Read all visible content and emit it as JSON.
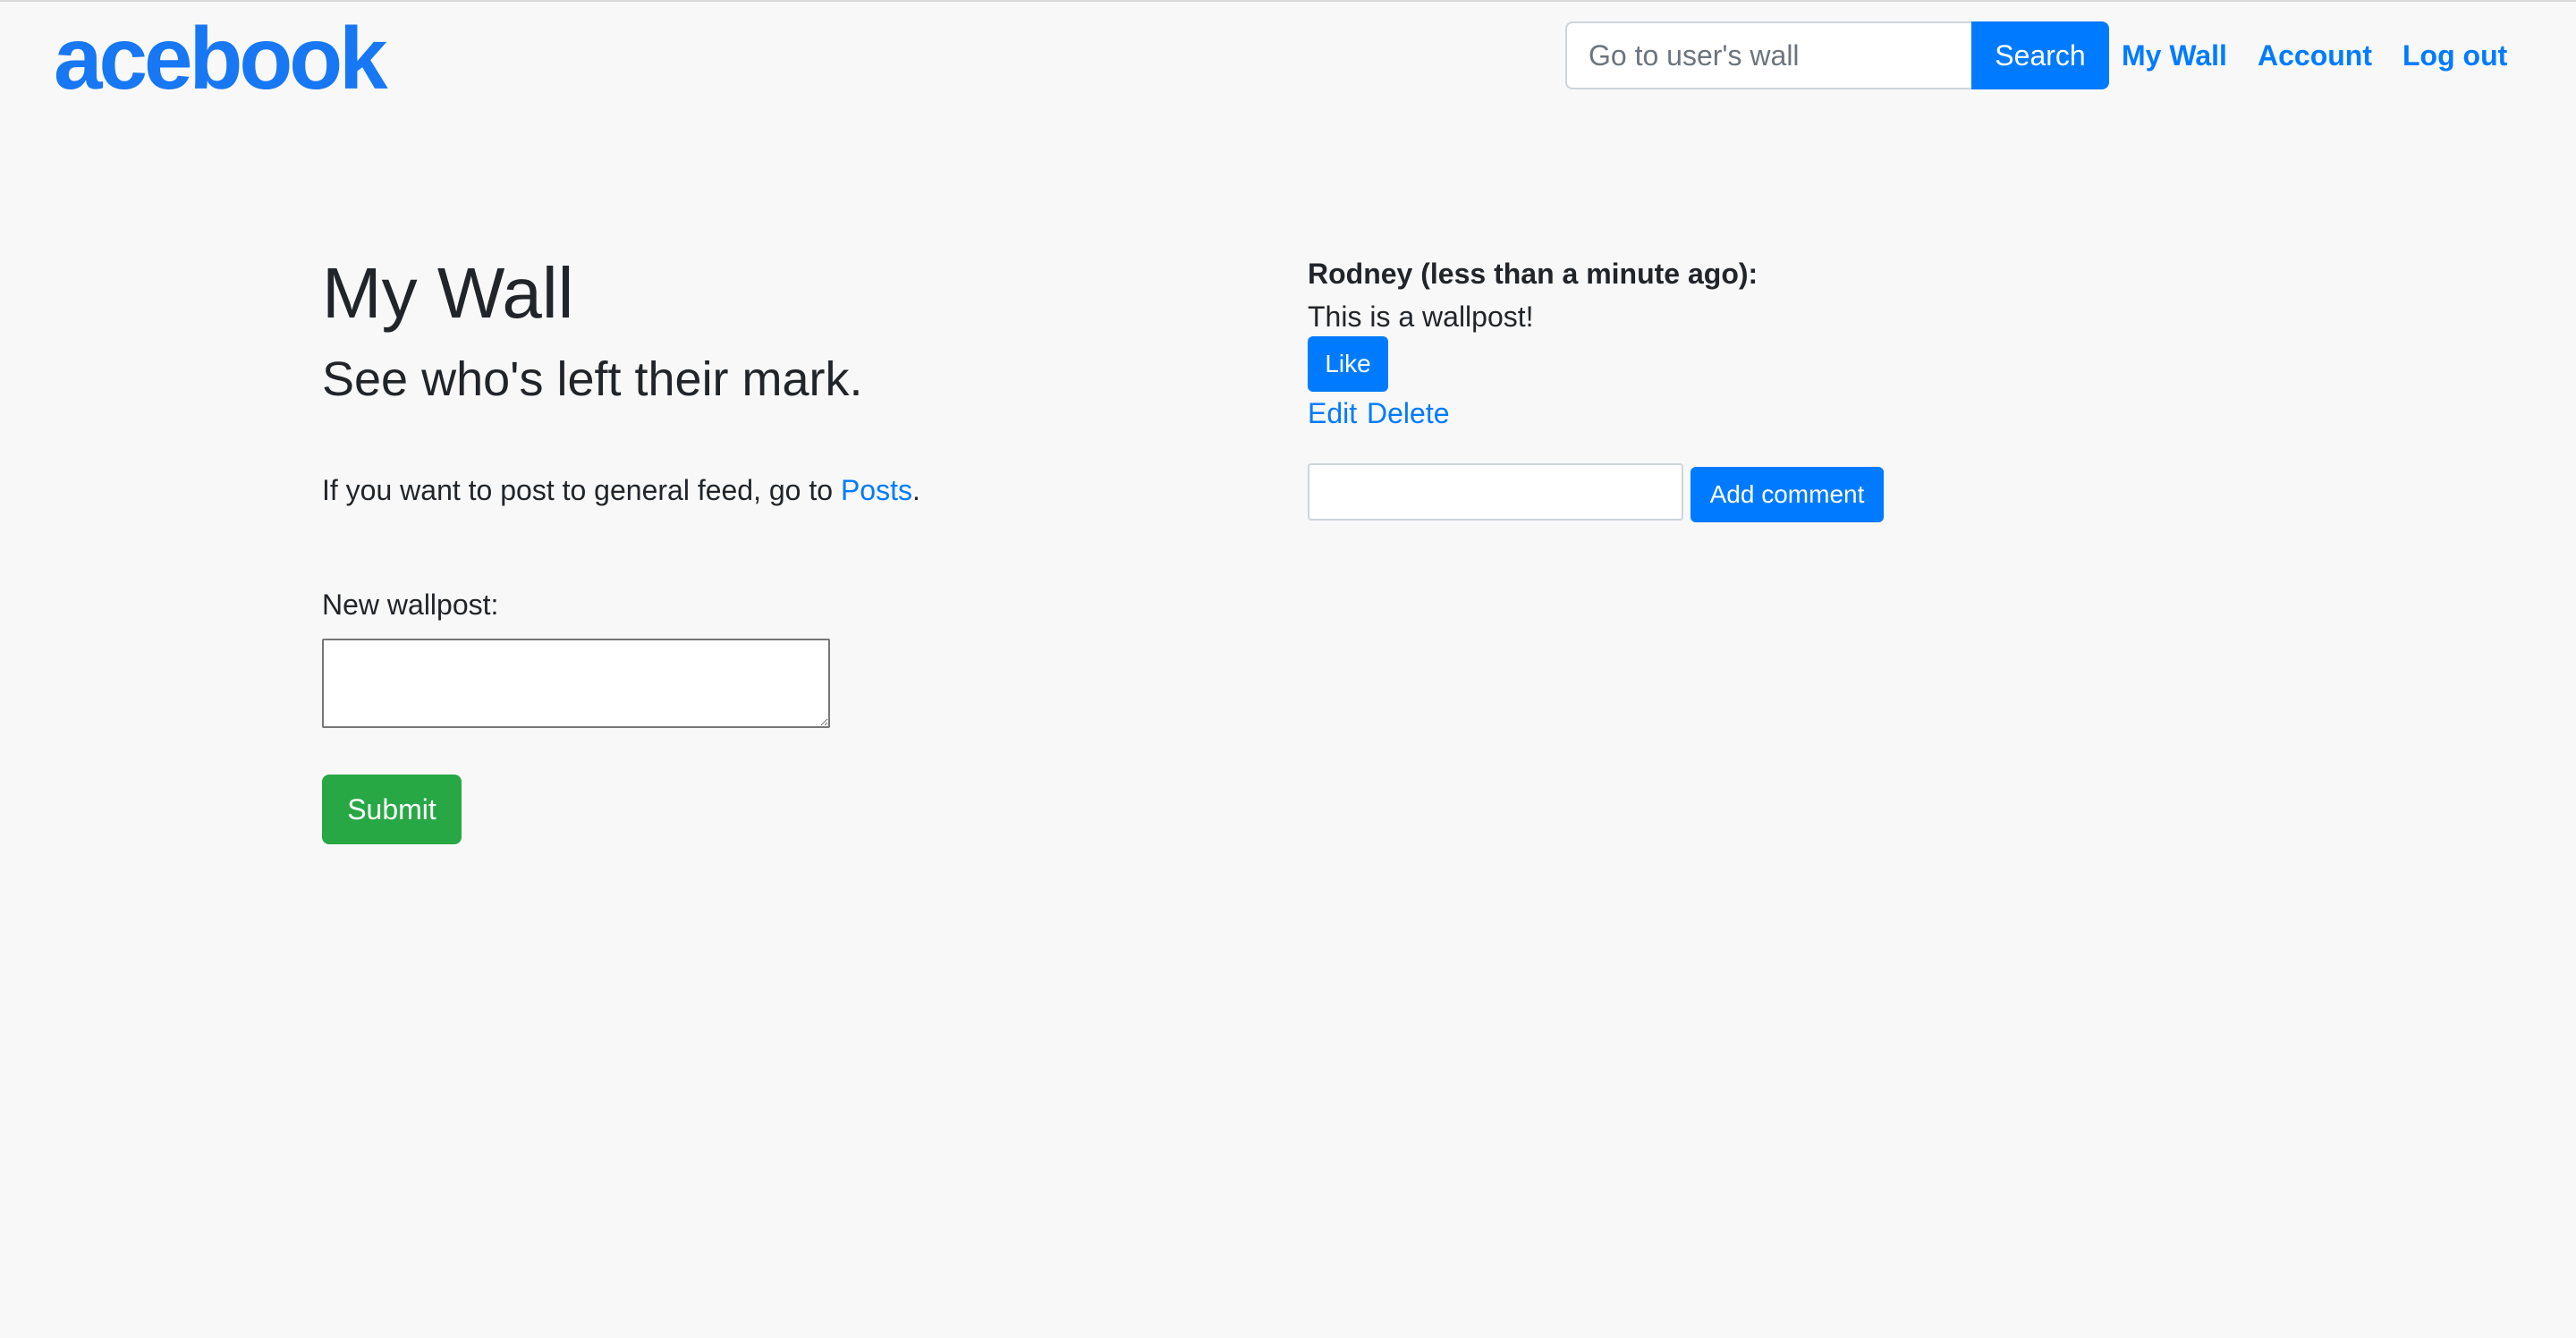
{
  "header": {
    "logo": "acebook",
    "search_placeholder": "Go to user's wall",
    "search_label": "Search",
    "nav": {
      "my_wall": "My Wall",
      "account": "Account",
      "log_out": "Log out"
    }
  },
  "main": {
    "title": "My Wall",
    "subtitle": "See who's left their mark.",
    "feed_text_before": "If you want to post to general feed, go to ",
    "feed_link": "Posts",
    "feed_text_after": ".",
    "new_wallpost_label": "New wallpost:",
    "new_wallpost_value": "",
    "submit_label": "Submit"
  },
  "posts": [
    {
      "author_line": "Rodney (less than a minute ago):",
      "body": "This is a wallpost!",
      "like_label": "Like",
      "edit_label": "Edit",
      "delete_label": "Delete",
      "comment_value": "",
      "add_comment_label": "Add comment"
    }
  ],
  "colors": {
    "brand": "#1877f2",
    "primary": "#007bff",
    "success": "#28a745",
    "background": "#f8f8f8",
    "text": "#212529"
  }
}
